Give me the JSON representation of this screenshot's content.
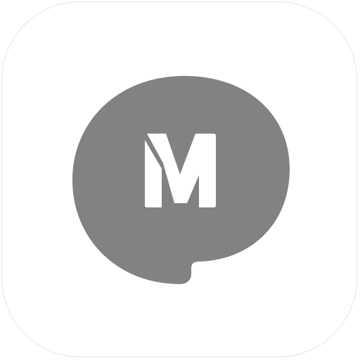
{
  "app_icon": {
    "name": "messenger-app-icon",
    "icon": "speech-bubble-icon",
    "logo_letter": "M",
    "colors": {
      "tile_background": "#ffffff",
      "tile_border": "#e6e6e6",
      "bubble": "#828282",
      "letter": "#ffffff"
    }
  }
}
